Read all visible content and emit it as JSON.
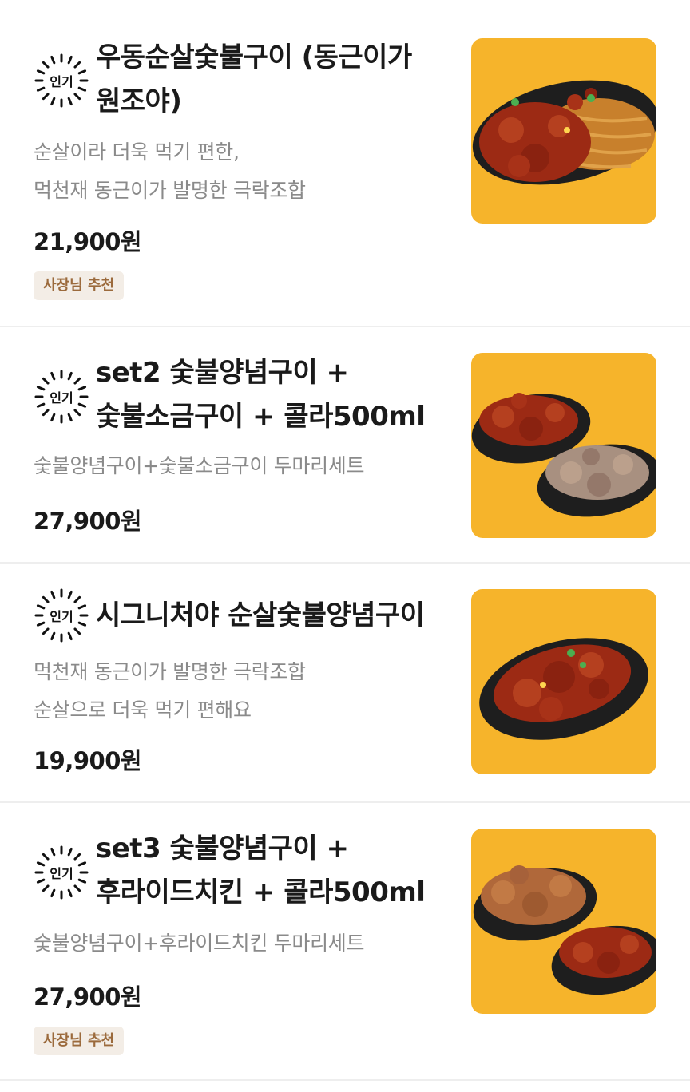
{
  "popular_badge_label": "인기",
  "items": [
    {
      "title_line1": "우동순살숯불구이 (동근이가",
      "title_line2": "원조야)",
      "desc_line1": "순살이라 더욱 먹기 편한,",
      "desc_line2": "먹천재 동근이가 발명한 극락조합",
      "price": "21,900원",
      "tag": "사장님 추천"
    },
    {
      "title_line1": "set2 숯불양념구이 +",
      "title_line2": "숯불소금구이 + 콜라500ml",
      "desc_line1": "숯불양념구이+숯불소금구이 두마리세트",
      "price": "27,900원"
    },
    {
      "title_line1": "시그니처야 순살숯불양념구이",
      "desc_line1": "먹천재 동근이가 발명한 극락조합",
      "desc_line2": "순살으로 더욱 먹기 편해요",
      "price": "19,900원"
    },
    {
      "title_line1": "set3 숯불양념구이 +",
      "title_line2": "후라이드치킨 + 콜라500ml",
      "desc_line1": "숯불양념구이+후라이드치킨 두마리세트",
      "price": "27,900원",
      "tag": "사장님 추천"
    }
  ],
  "colors": {
    "thumb_background": "#f6b42b",
    "tag_background": "#f3ede6",
    "tag_text": "#9b6a3c",
    "price_text": "#1a1a1a",
    "desc_text": "#8a8a8a"
  },
  "icons": [
    "popular-burst-icon"
  ]
}
